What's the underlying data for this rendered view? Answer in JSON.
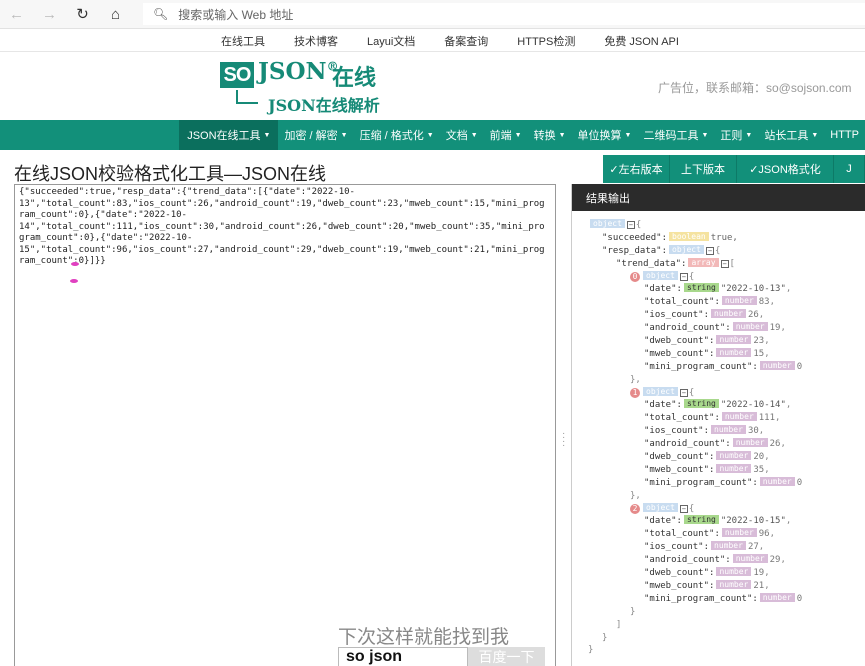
{
  "browser": {
    "address_placeholder": "搜索或输入 Web 地址"
  },
  "top_links": [
    "在线工具",
    "技术博客",
    "Layui文档",
    "备案查询",
    "HTTPS检测",
    "免费 JSON API"
  ],
  "header": {
    "logo_box": "SO",
    "logo_json": "JSON",
    "logo_reg": "®",
    "logo_cn": "在线",
    "logo_sub": "JSON在线解析",
    "ad_text": "广告位，联系邮箱：so@sojson.com"
  },
  "nav": [
    {
      "label": "JSON在线工具",
      "active": true
    },
    {
      "label": "加密 / 解密"
    },
    {
      "label": "压缩 / 格式化"
    },
    {
      "label": "文档"
    },
    {
      "label": "前端"
    },
    {
      "label": "转换"
    },
    {
      "label": "单位换算"
    },
    {
      "label": "二维码工具"
    },
    {
      "label": "正则"
    },
    {
      "label": "站长工具"
    },
    {
      "label": "HTTP"
    }
  ],
  "page_title": "在线JSON校验格式化工具—JSON在线",
  "buttons": [
    "✓左右版本",
    "上下版本",
    "✓JSON格式化",
    "J"
  ],
  "editor_lines": [
    "{\"succeeded\":true,\"resp_data\":{\"trend_data\":[{\"date\":\"2022-10-",
    "13\",\"total_count\":83,\"ios_count\":26,\"android_count\":19,\"dweb_count\":23,\"mweb_count\":15,\"mini_prog",
    "ram_count\":0},{\"date\":\"2022-10-",
    "14\",\"total_count\":111,\"ios_count\":30,\"android_count\":26,\"dweb_count\":20,\"mweb_count\":35,\"mini_pro",
    "gram_count\":0},{\"date\":\"2022-10-",
    "15\",\"total_count\":96,\"ios_count\":27,\"android_count\":29,\"dweb_count\":19,\"mweb_count\":21,\"mini_prog",
    "ram_count\":0}]}}"
  ],
  "baidu": {
    "slogan": "下次这样就能找到我",
    "input": "so json",
    "button": "百度一下"
  },
  "result": {
    "header": "结果输出",
    "items": [
      {
        "index": "0",
        "date": "\"2022-10-13\"",
        "total_count": "83",
        "ios_count": "26",
        "android_count": "19",
        "dweb_count": "23",
        "mweb_count": "15",
        "mini_program_count": "0"
      },
      {
        "index": "1",
        "date": "\"2022-10-14\"",
        "total_count": "111",
        "ios_count": "30",
        "android_count": "26",
        "dweb_count": "20",
        "mweb_count": "35",
        "mini_program_count": "0"
      },
      {
        "index": "2",
        "date": "\"2022-10-15\"",
        "total_count": "96",
        "ios_count": "27",
        "android_count": "29",
        "dweb_count": "19",
        "mweb_count": "21",
        "mini_program_count": "0"
      }
    ],
    "labels": {
      "object": "object",
      "boolean": "boolean",
      "array": "array",
      "string": "string",
      "number": "number",
      "succeeded_key": "\"succeeded\":",
      "succeeded_val": "true,",
      "resp_key": "\"resp_data\":",
      "trend_key": "\"trend_data\":",
      "date_key": "\"date\":",
      "total_key": "\"total_count\":",
      "ios_key": "\"ios_count\":",
      "android_key": "\"android_count\":",
      "dweb_key": "\"dweb_count\":",
      "mweb_key": "\"mweb_count\":",
      "mini_key": "\"mini_program_count\":"
    }
  }
}
